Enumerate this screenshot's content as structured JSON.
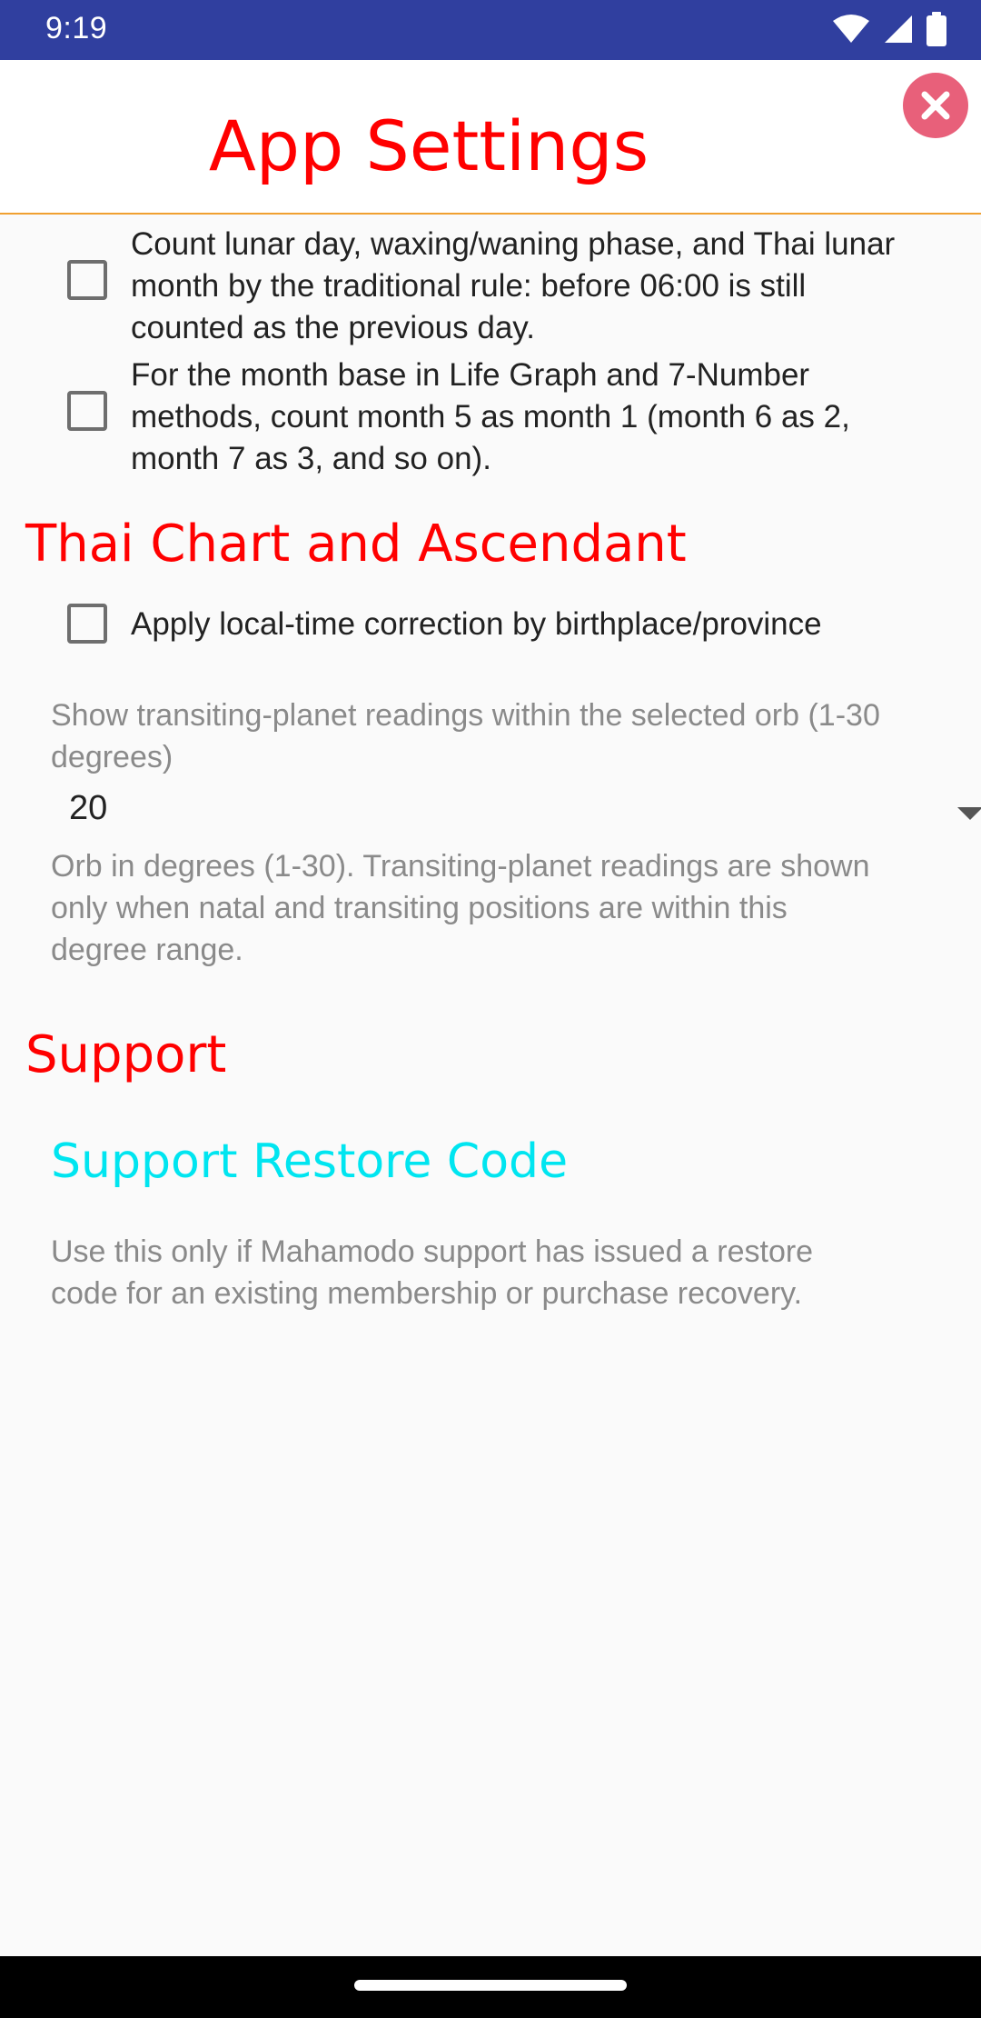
{
  "status_bar": {
    "time": "9:19",
    "icons": [
      "wifi-icon",
      "signal-icon",
      "battery-icon"
    ]
  },
  "header": {
    "title": "App Settings",
    "close_icon": "close-icon",
    "colors": {
      "title": "#FF0000",
      "close_bg": "#E8607A",
      "divider": "#F0A030"
    }
  },
  "options": [
    {
      "lines": [
        "Count lunar day, waxing/waning phase, and Thai lunar",
        "month by the traditional rule: before 06:00 is still",
        "counted as the previous day."
      ],
      "checked": false
    },
    {
      "lines": [
        "For the month base in Life Graph and 7-Number",
        "methods, count month 5 as month 1 (month 6 as 2,",
        "month 7 as 3, and so on)."
      ],
      "checked": false
    }
  ],
  "thai_chart": {
    "section_title": "Thai Chart and Ascendant",
    "local_time_option": {
      "label": "Apply local-time correction by birthplace/province",
      "checked": false
    },
    "orb": {
      "label_lines": [
        "Show transiting-planet readings within the selected orb (1-30",
        "degrees)"
      ],
      "selected_value": "20",
      "help_lines": [
        "Orb in degrees (1-30). Transiting-planet readings are shown",
        "only when natal and transiting positions are within this",
        "degree range."
      ]
    }
  },
  "support": {
    "section_title": "Support",
    "restore_title": "Support Restore Code",
    "restore_desc_lines": [
      "Use this only if Mahamodo support has issued a restore",
      "code for an existing membership or purchase recovery."
    ]
  },
  "colors": {
    "status_bar": "#303F9F",
    "section_title": "#FF0000",
    "link": "#00E5F0",
    "secondary_text": "#8A8A8A"
  }
}
